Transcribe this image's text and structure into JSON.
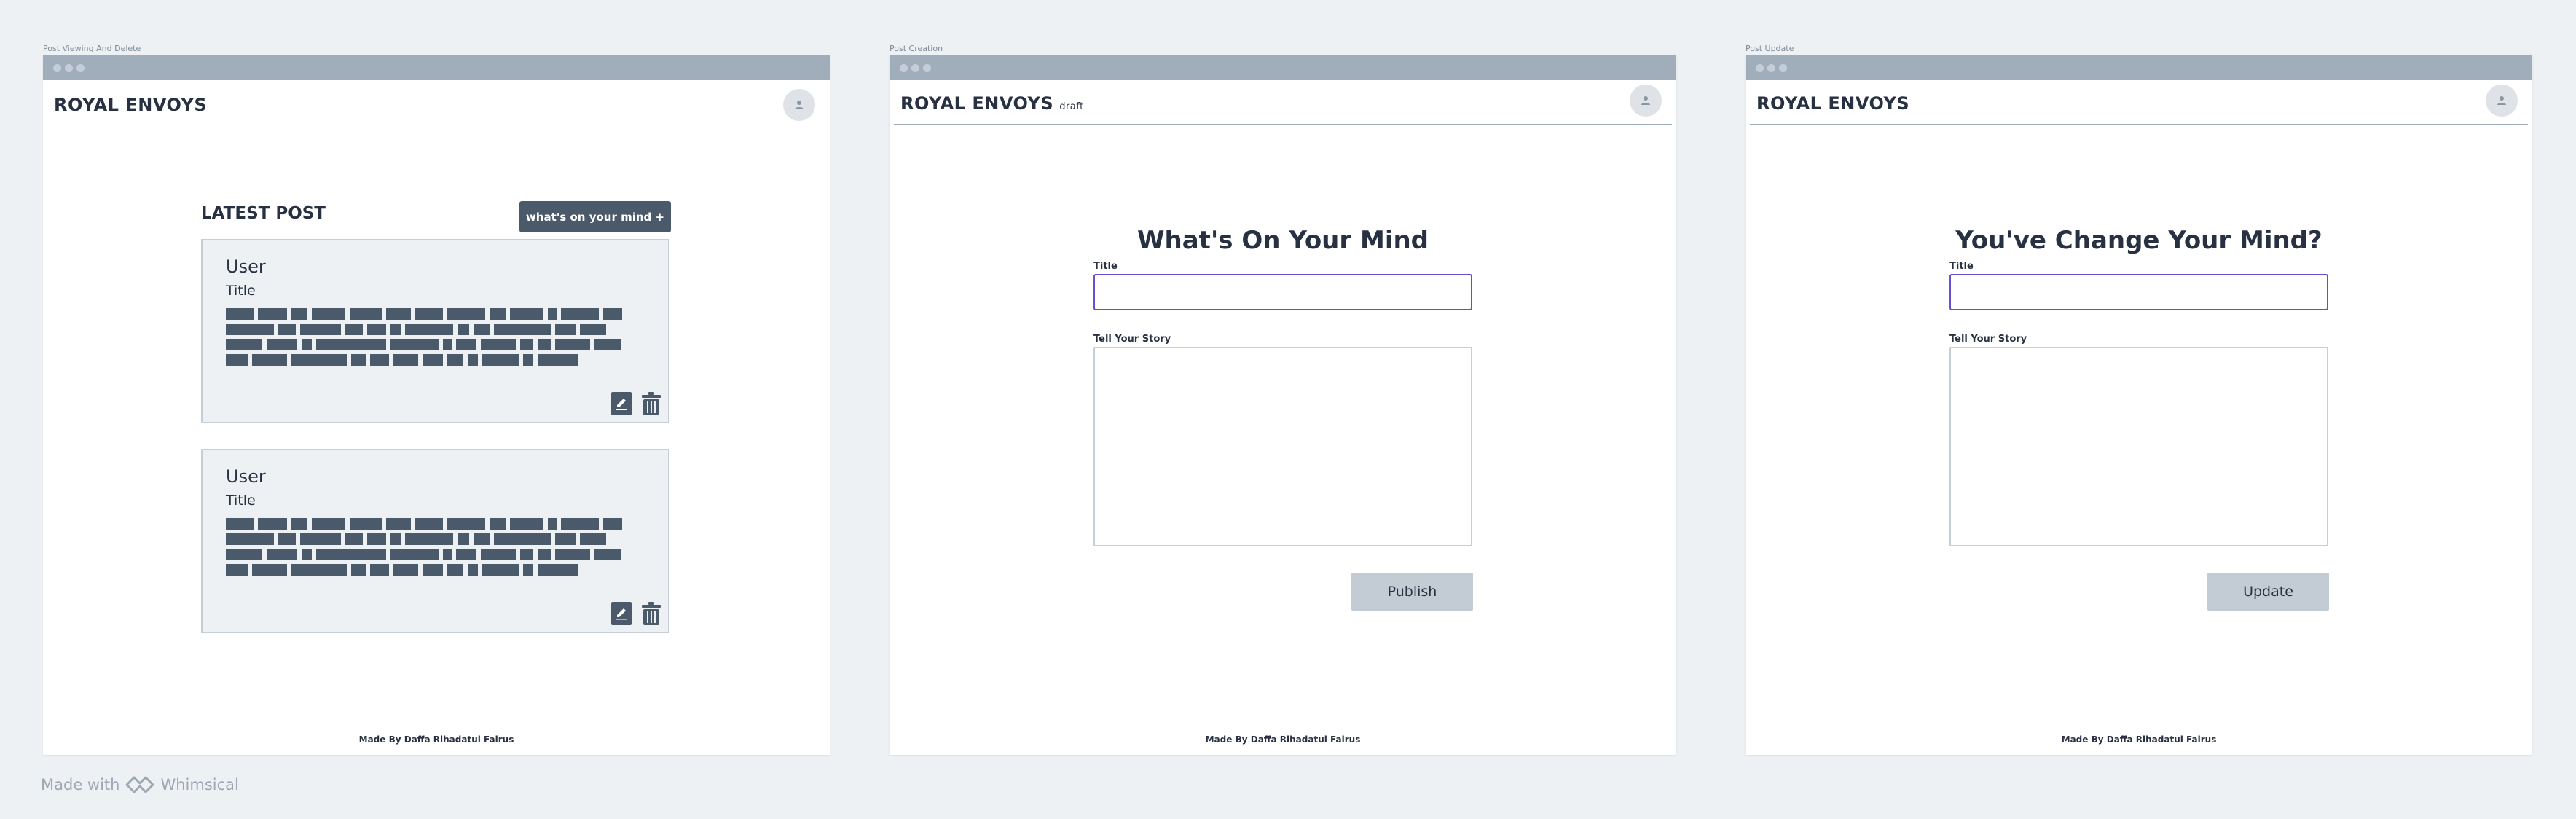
{
  "frames": [
    {
      "label": "Post Viewing And Delete",
      "brand": "ROYAL ENVOYS",
      "section_title": "LATEST POST",
      "cta_label": "what's on your mind +",
      "posts": [
        {
          "user": "User",
          "title": "Title"
        },
        {
          "user": "User",
          "title": "Title"
        }
      ],
      "footer": "Made By Daffa Rihadatul Fairus"
    },
    {
      "label": "Post Creation",
      "brand": "ROYAL ENVOYS",
      "badge": "draft",
      "heading": "What's On Your Mind",
      "title_label": "Title",
      "story_label": "Tell Your Story",
      "button_label": "Publish",
      "footer": "Made By Daffa Rihadatul Fairus"
    },
    {
      "label": "Post Update",
      "brand": "ROYAL ENVOYS",
      "heading": "You've Change Your Mind?",
      "title_label": "Title",
      "story_label": "Tell Your Story",
      "button_label": "Update",
      "footer": "Made By Daffa Rihadatul Fairus"
    }
  ],
  "watermark": {
    "prefix": "Made with",
    "brand": "Whimsical"
  },
  "icons": {
    "avatar": "user-avatar-icon",
    "edit": "pencil-edit-icon",
    "delete": "trash-icon",
    "logo": "whimsical-logo-icon"
  },
  "colors": {
    "canvas": "#eef1f4",
    "titlebar": "#a0aebb",
    "text": "#273142",
    "placeholder_text_block": "#4a5a6b",
    "input_focus": "#6a4ed0",
    "button_muted": "#c3ccd5"
  }
}
